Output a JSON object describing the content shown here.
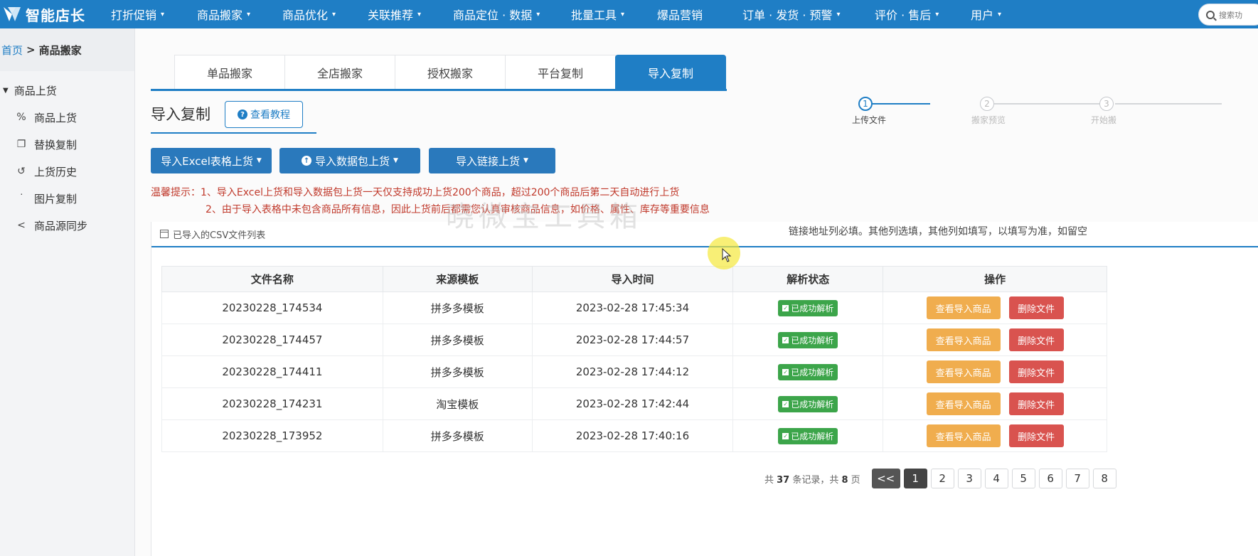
{
  "app": {
    "name": "智能店长"
  },
  "topnav": {
    "items": [
      {
        "label": "打折促销",
        "dd": "▾"
      },
      {
        "label": "商品搬家",
        "dd": "▾"
      },
      {
        "label": "商品优化",
        "dd": "▾"
      },
      {
        "label": "关联推荐",
        "dd": "▾"
      },
      {
        "label": "商品定位 · 数据",
        "dd": "▾"
      },
      {
        "label": "批量工具",
        "dd": "▾"
      },
      {
        "label": "爆品营销",
        "dd": ""
      },
      {
        "label": "订单 · 发货 · 预警",
        "dd": "▾"
      },
      {
        "label": "评价 · 售后",
        "dd": "▾"
      },
      {
        "label": "用户",
        "dd": "▾"
      }
    ],
    "search_placeholder": "搜索功"
  },
  "breadcrumb": {
    "home": "首页",
    "sep": ">",
    "current": "商品搬家"
  },
  "sidebar": {
    "group": "商品上货",
    "items": [
      {
        "label": "商品上货",
        "icon": "link-icon"
      },
      {
        "label": "替换复制",
        "icon": "copy-icon"
      },
      {
        "label": "上货历史",
        "icon": "history-icon"
      },
      {
        "label": "图片复制",
        "icon": "sitemap-icon"
      },
      {
        "label": "商品源同步",
        "icon": "share-icon"
      }
    ]
  },
  "tabs": [
    {
      "label": "单品搬家",
      "active": false
    },
    {
      "label": "全店搬家",
      "active": false
    },
    {
      "label": "授权搬家",
      "active": false
    },
    {
      "label": "平台复制",
      "active": false
    },
    {
      "label": "导入复制",
      "active": true
    }
  ],
  "section": {
    "title": "导入复制",
    "tutorial": "查看教程"
  },
  "steps": [
    {
      "num": "1",
      "label": "上传文件",
      "active": true
    },
    {
      "num": "2",
      "label": "搬家预览",
      "active": false
    },
    {
      "num": "3",
      "label": "开始搬",
      "active": false
    }
  ],
  "actions": [
    {
      "label": "导入Excel表格上货"
    },
    {
      "label": "导入数据包上货"
    },
    {
      "label": "导入链接上货"
    }
  ],
  "notice": {
    "prefix": "温馨提示：",
    "line1": "1、导入Excel上货和导入数据包上货一天仅支持成功上货200个商品，超过200个商品后第二天自动进行上货",
    "line2": "2、由于导入表格中未包含商品所有信息，因此上货前后都需您认真审核商品信息，如价格、属性、库存等重要信息"
  },
  "panel": {
    "title": "已导入的CSV文件列表",
    "hint": "链接地址列必填。其他列选填，其他列如填写，以填写为准，如留空",
    "watermark": "晓微宝工具箱"
  },
  "table": {
    "headers": [
      "文件名称",
      "来源模板",
      "导入时间",
      "解析状态",
      "操作"
    ],
    "status_label": "已成功解析",
    "view_label": "查看导入商品",
    "delete_label": "删除文件",
    "rows": [
      {
        "file": "20230228_174534",
        "template": "拼多多模板",
        "time": "2023-02-28 17:45:34"
      },
      {
        "file": "20230228_174457",
        "template": "拼多多模板",
        "time": "2023-02-28 17:44:57"
      },
      {
        "file": "20230228_174411",
        "template": "拼多多模板",
        "time": "2023-02-28 17:44:12"
      },
      {
        "file": "20230228_174231",
        "template": "淘宝模板",
        "time": "2023-02-28 17:42:44"
      },
      {
        "file": "20230228_173952",
        "template": "拼多多模板",
        "time": "2023-02-28 17:40:16"
      }
    ]
  },
  "pagination": {
    "info_pre": "共 ",
    "total": "37",
    "info_mid": " 条记录，共 ",
    "pages": "8",
    "info_post": " 页",
    "prev": "<<",
    "numbers": [
      "1",
      "2",
      "3",
      "4",
      "5",
      "6",
      "7",
      "8"
    ],
    "current": "1"
  },
  "colors": {
    "primary": "#1f7ec5",
    "success": "#3ca54a",
    "warning": "#f0ad4e",
    "danger": "#d9534f",
    "notice": "#c0392b"
  }
}
